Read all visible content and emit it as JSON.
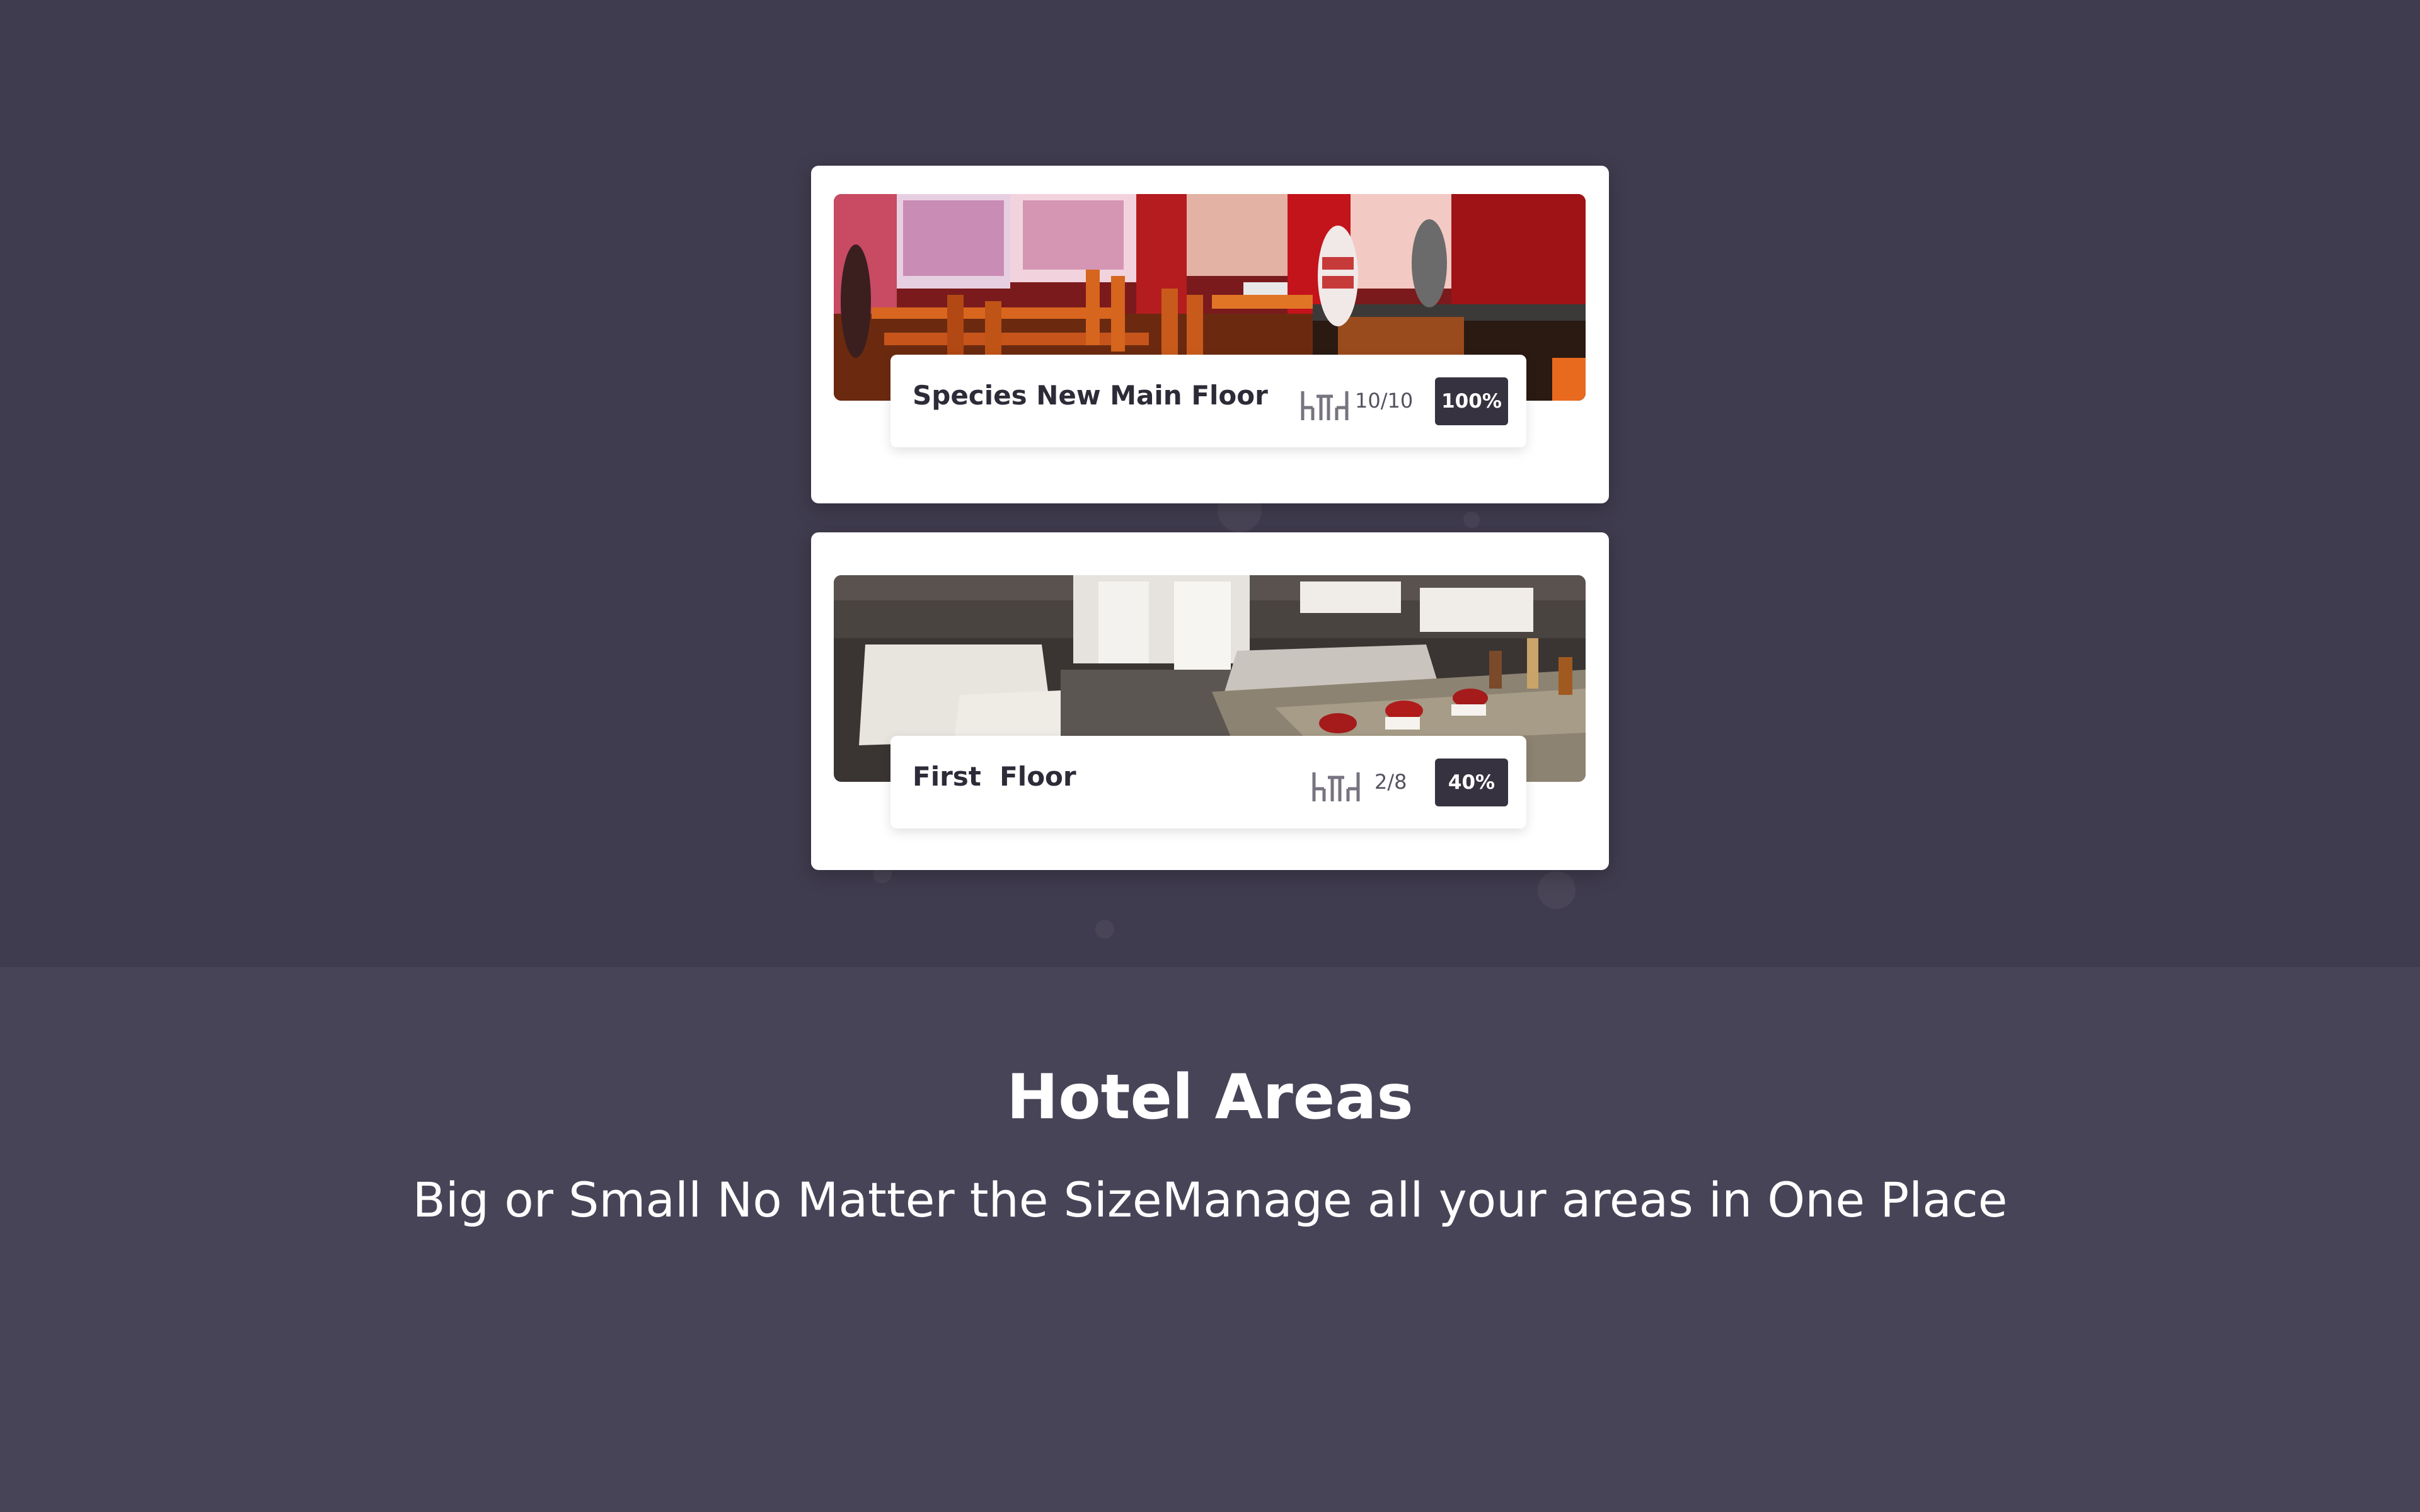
{
  "areas": [
    {
      "name": "Species New Main Floor",
      "tables": "10/10",
      "occupancy": "100%",
      "photo": "restaurant-red-interior"
    },
    {
      "name": "First  Floor",
      "tables": "2/8",
      "occupancy": "40%",
      "photo": "restaurant-white-tablecloth-interior"
    }
  ],
  "section": {
    "title": "Hotel Areas",
    "subtitle": "Big or Small No Matter the SizeManage all your areas in One Place"
  },
  "colors": {
    "background": "#403c4f",
    "lower_background": "#484458",
    "badge": "#36323f",
    "card": "#ffffff"
  }
}
